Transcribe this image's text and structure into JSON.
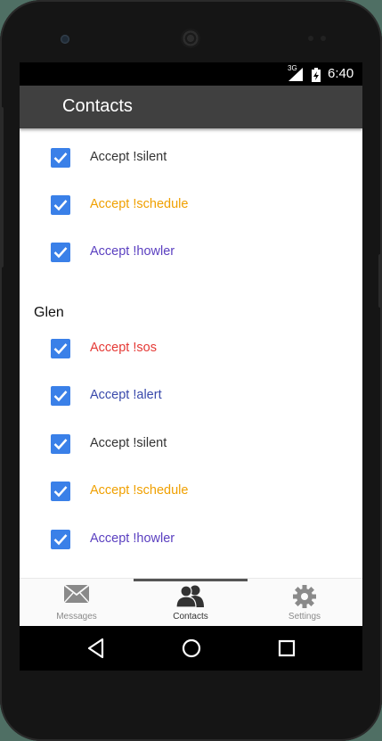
{
  "status_bar": {
    "network": "3G",
    "time": "6:40"
  },
  "app_bar": {
    "title": "Contacts"
  },
  "rows_top": [
    {
      "label": "Accept !silent",
      "color": "#333333",
      "checked": true
    },
    {
      "label": "Accept !schedule",
      "color": "#f0a000",
      "checked": true
    },
    {
      "label": "Accept !howler",
      "color": "#5a3fc0",
      "checked": true
    }
  ],
  "group": {
    "name": "Glen"
  },
  "rows_group": [
    {
      "label": "Accept !sos",
      "color": "#e53935",
      "checked": true
    },
    {
      "label": "Accept !alert",
      "color": "#3949ab",
      "checked": true
    },
    {
      "label": "Accept !silent",
      "color": "#333333",
      "checked": true
    },
    {
      "label": "Accept !schedule",
      "color": "#f0a000",
      "checked": true
    },
    {
      "label": "Accept !howler",
      "color": "#5a3fc0",
      "checked": true
    }
  ],
  "bottom_nav": [
    {
      "label": "Messages",
      "icon": "envelope-icon",
      "active": false
    },
    {
      "label": "Contacts",
      "icon": "people-icon",
      "active": true
    },
    {
      "label": "Settings",
      "icon": "gear-icon",
      "active": false
    }
  ],
  "colors": {
    "checkbox": "#3a80e8",
    "app_bar": "#404040"
  }
}
